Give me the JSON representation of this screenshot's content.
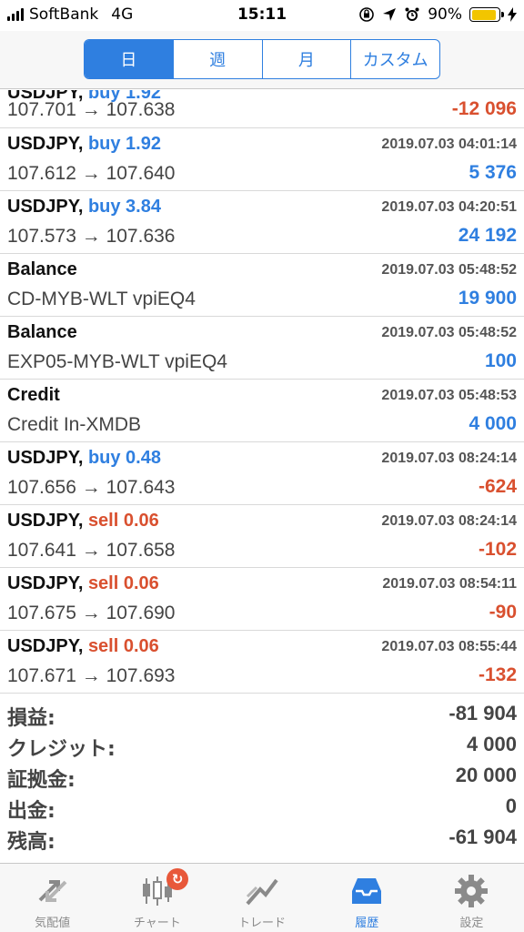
{
  "status_bar": {
    "carrier": "SoftBank",
    "network": "4G",
    "time": "15:11",
    "battery": "90%",
    "battery_level": 0.9
  },
  "period_tabs": [
    {
      "label": "日",
      "active": true
    },
    {
      "label": "週",
      "active": false
    },
    {
      "label": "月",
      "active": false
    },
    {
      "label": "カスタム",
      "active": false
    }
  ],
  "history": [
    {
      "symbol": "",
      "side": "",
      "side_type": "",
      "time": "",
      "detail": "107.701 → 107.638",
      "value": "-12 096",
      "value_type": "neg"
    },
    {
      "symbol": "USDJPY,",
      "side": "buy 1.92",
      "side_type": "buy",
      "time": "2019.07.03 04:01:14",
      "detail": "107.612 → 107.640",
      "value": "5 376",
      "value_type": "pos"
    },
    {
      "symbol": "USDJPY,",
      "side": "buy 3.84",
      "side_type": "buy",
      "time": "2019.07.03 04:20:51",
      "detail": "107.573 → 107.636",
      "value": "24 192",
      "value_type": "pos"
    },
    {
      "symbol": "Balance",
      "side": "",
      "side_type": "",
      "time": "2019.07.03 05:48:52",
      "detail": "CD-MYB-WLT vpiEQ4",
      "value": "19 900",
      "value_type": "pos"
    },
    {
      "symbol": "Balance",
      "side": "",
      "side_type": "",
      "time": "2019.07.03 05:48:52",
      "detail": "EXP05-MYB-WLT vpiEQ4",
      "value": "100",
      "value_type": "pos"
    },
    {
      "symbol": "Credit",
      "side": "",
      "side_type": "",
      "time": "2019.07.03 05:48:53",
      "detail": "Credit In-XMDB",
      "value": "4 000",
      "value_type": "pos"
    },
    {
      "symbol": "USDJPY,",
      "side": "buy 0.48",
      "side_type": "buy",
      "time": "2019.07.03 08:24:14",
      "detail": "107.656 → 107.643",
      "value": "-624",
      "value_type": "neg"
    },
    {
      "symbol": "USDJPY,",
      "side": "sell 0.06",
      "side_type": "sell",
      "time": "2019.07.03 08:24:14",
      "detail": "107.641 → 107.658",
      "value": "-102",
      "value_type": "neg"
    },
    {
      "symbol": "USDJPY,",
      "side": "sell 0.06",
      "side_type": "sell",
      "time": "2019.07.03 08:54:11",
      "detail": "107.675 → 107.690",
      "value": "-90",
      "value_type": "neg"
    },
    {
      "symbol": "USDJPY,",
      "side": "sell 0.06",
      "side_type": "sell",
      "time": "2019.07.03 08:55:44",
      "detail": "107.671 → 107.693",
      "value": "-132",
      "value_type": "neg"
    }
  ],
  "summary": [
    {
      "label": "損益:",
      "value": "-81 904"
    },
    {
      "label": "クレジット:",
      "value": "4 000"
    },
    {
      "label": "証拠金:",
      "value": "20 000"
    },
    {
      "label": "出金:",
      "value": "0"
    },
    {
      "label": "残高:",
      "value": "-61 904"
    }
  ],
  "tabbar": [
    {
      "label": "気配値",
      "icon": "quotes-icon",
      "active": false
    },
    {
      "label": "チャート",
      "icon": "chart-icon",
      "active": false,
      "badge": "↻"
    },
    {
      "label": "トレード",
      "icon": "trade-icon",
      "active": false
    },
    {
      "label": "履歴",
      "icon": "history-icon",
      "active": true
    },
    {
      "label": "設定",
      "icon": "settings-icon",
      "active": false
    }
  ],
  "colors": {
    "accent": "#2f7fe0",
    "negative": "#d9502f",
    "battery": "#f2c500",
    "badge": "#e8583a"
  }
}
